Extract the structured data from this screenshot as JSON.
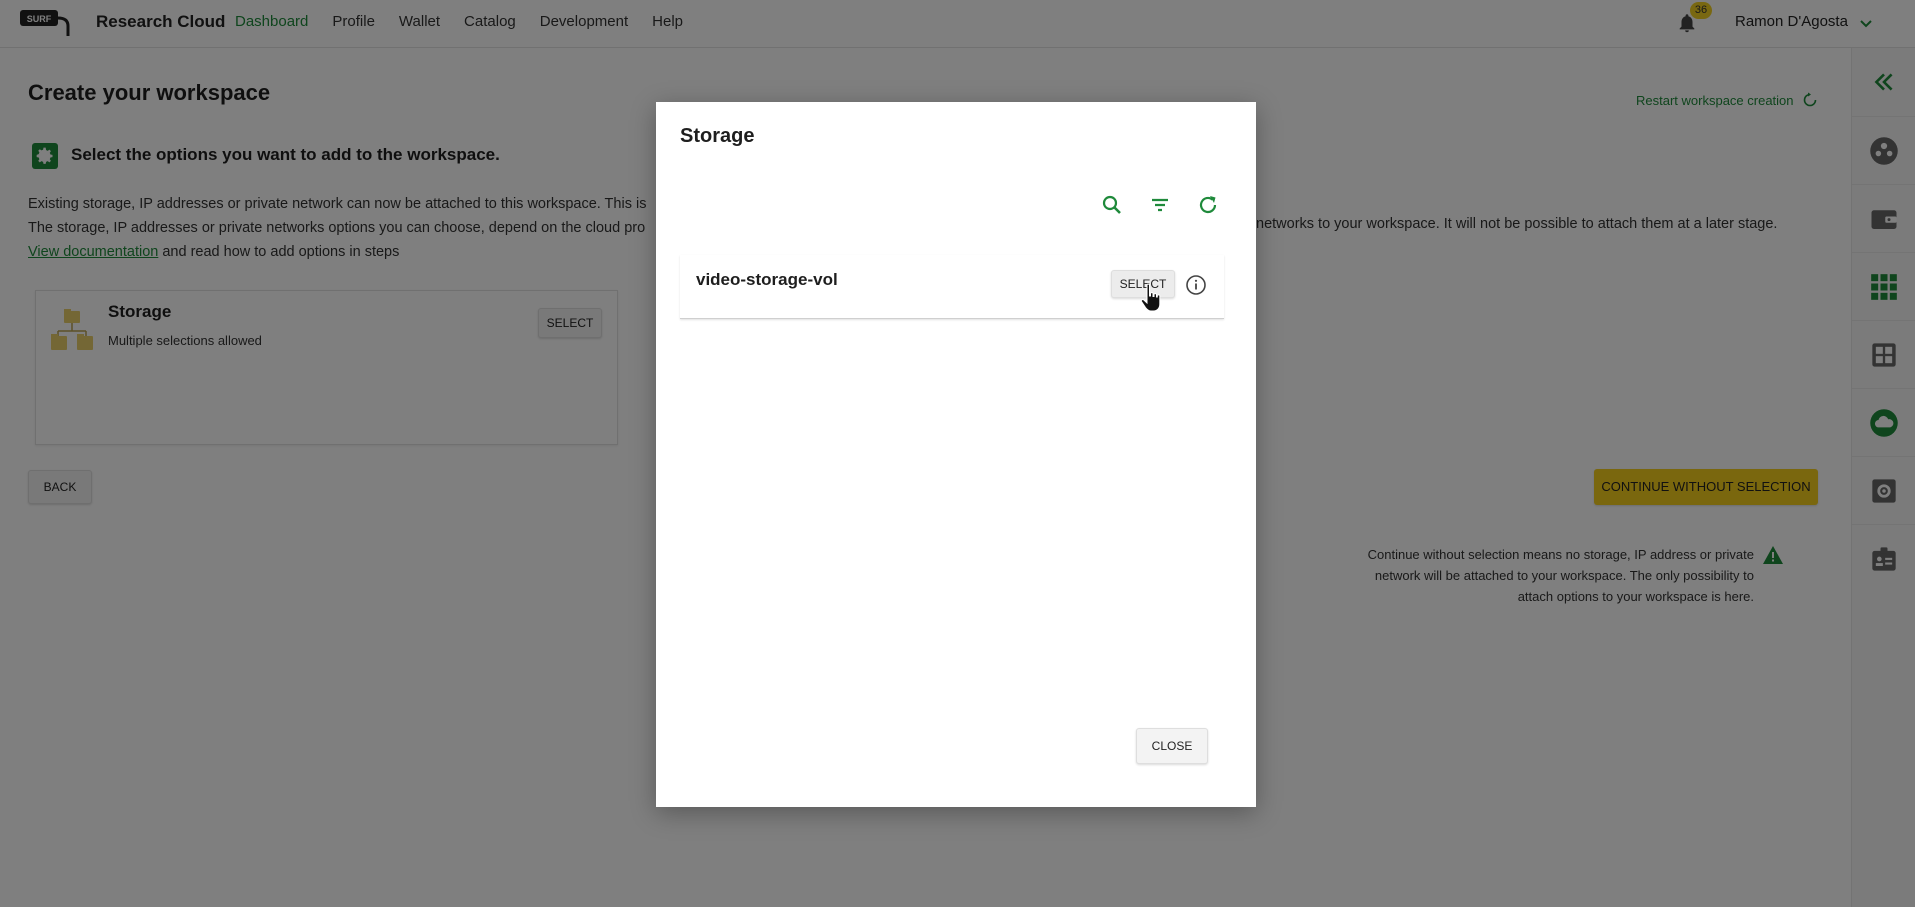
{
  "header": {
    "logo_text": "SURF",
    "app_title": "Research Cloud",
    "nav": [
      "Dashboard",
      "Profile",
      "Wallet",
      "Catalog",
      "Development",
      "Help"
    ],
    "active_nav": "Dashboard",
    "notification_count": "36",
    "username": "Ramon D'Agosta"
  },
  "page": {
    "title": "Create your workspace",
    "restart_label": "Restart workspace creation",
    "section_heading": "Select the options you want to add to the workspace.",
    "intro_line1": "Existing storage, IP addresses or private network can now be attached to this workspace. This is",
    "intro_line2": "The storage, IP addresses or private networks options you can choose, depend on the cloud pro",
    "intro_line2_end": "networks to your workspace. It will not be possible to attach them at a later stage.",
    "doc_link": "View documentation",
    "intro_line3_rest": " and read how to add options in steps",
    "back_label": "BACK",
    "continue_label": "CONTINUE WITHOUT SELECTION",
    "note_lines": [
      "Continue without selection means no storage, IP address or private",
      "network will be attached to your workspace. The only possibility to",
      "attach options to your workspace is here."
    ]
  },
  "storage_card": {
    "title": "Storage",
    "subtitle": "Multiple selections allowed",
    "select_label": "SELECT"
  },
  "modal": {
    "title": "Storage",
    "items": [
      {
        "name": "video-storage-vol",
        "select_label": "SELECT"
      }
    ],
    "close_label": "CLOSE"
  },
  "icons": {
    "notification": "bell-icon",
    "rail": [
      "collapse-icon",
      "team-icon",
      "wallet-icon",
      "apps-grid-icon",
      "dashboard-icon",
      "cloud-icon",
      "settings-icon",
      "id-card-icon"
    ],
    "modal_tools": [
      "search-icon",
      "filter-icon",
      "refresh-icon"
    ]
  },
  "colors": {
    "accent_green": "#1f8a3b",
    "accent_yellow": "#f5cf1c"
  }
}
